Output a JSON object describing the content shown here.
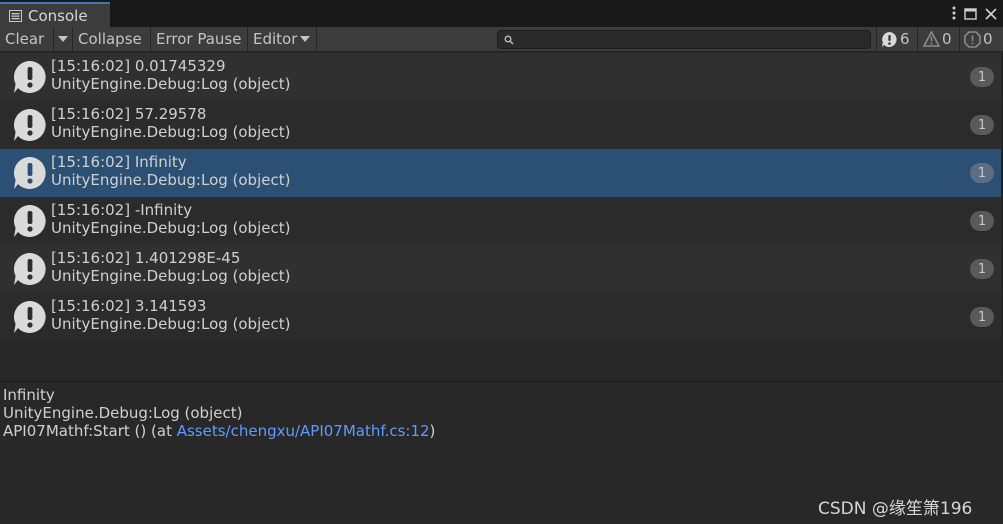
{
  "window": {
    "tab_title": "Console",
    "icons": [
      "console-list-icon",
      "more-vertical-icon",
      "maximize-icon",
      "close-icon"
    ]
  },
  "toolbar": {
    "clear_label": "Clear",
    "collapse_label": "Collapse",
    "error_pause_label": "Error Pause",
    "editor_label": "Editor",
    "search_placeholder": "",
    "log_count": "6",
    "warning_count": "0",
    "error_count": "0"
  },
  "logs": [
    {
      "time_message": "[15:16:02] 0.01745329",
      "stack": "UnityEngine.Debug:Log (object)",
      "count": "1",
      "selected": false
    },
    {
      "time_message": "[15:16:02] 57.29578",
      "stack": "UnityEngine.Debug:Log (object)",
      "count": "1",
      "selected": false
    },
    {
      "time_message": "[15:16:02] Infinity",
      "stack": "UnityEngine.Debug:Log (object)",
      "count": "1",
      "selected": true
    },
    {
      "time_message": "[15:16:02] -Infinity",
      "stack": "UnityEngine.Debug:Log (object)",
      "count": "1",
      "selected": false
    },
    {
      "time_message": "[15:16:02] 1.401298E-45",
      "stack": "UnityEngine.Debug:Log (object)",
      "count": "1",
      "selected": false
    },
    {
      "time_message": "[15:16:02] 3.141593",
      "stack": "UnityEngine.Debug:Log (object)",
      "count": "1",
      "selected": false
    }
  ],
  "detail": {
    "message": "Infinity",
    "stack_line1": "UnityEngine.Debug:Log (object)",
    "stack_line2_prefix": "API07Mathf:Start () (at ",
    "stack_line2_link": "Assets/chengxu/API07Mathf.cs:12",
    "stack_line2_suffix": ")"
  },
  "watermark": "CSDN @缘笙箫196",
  "colors": {
    "selected_row": "#2b5074",
    "link": "#5f9bff",
    "tab_accent": "#3a79bb"
  }
}
